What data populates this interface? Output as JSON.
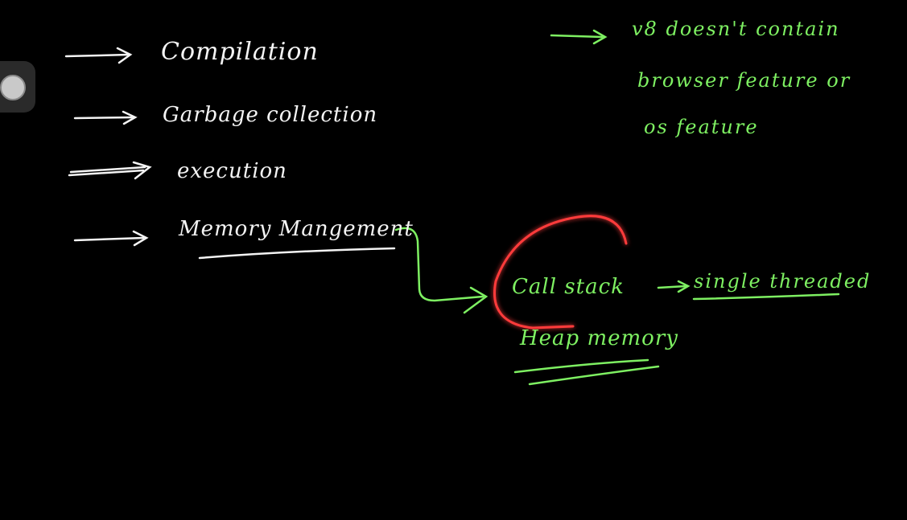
{
  "board": {
    "white_notes": {
      "compilation": "Compilation",
      "garbage_collection": "Garbage collection",
      "execution": "execution",
      "memory_management": "Memory Mangement"
    },
    "green_notes": {
      "v8_line1": "v8 doesn't contain",
      "v8_line2": "browser feature or",
      "v8_line3": "os feature",
      "call_stack": "Call stack",
      "single_threaded": "single threaded",
      "heap_memory": "Heap memory"
    },
    "colors": {
      "background": "#000000",
      "white_ink": "#f4f4f4",
      "green_ink": "#7ef062",
      "highlight": "#ff3b3b"
    },
    "tool_icon": "pen-tool-icon"
  }
}
